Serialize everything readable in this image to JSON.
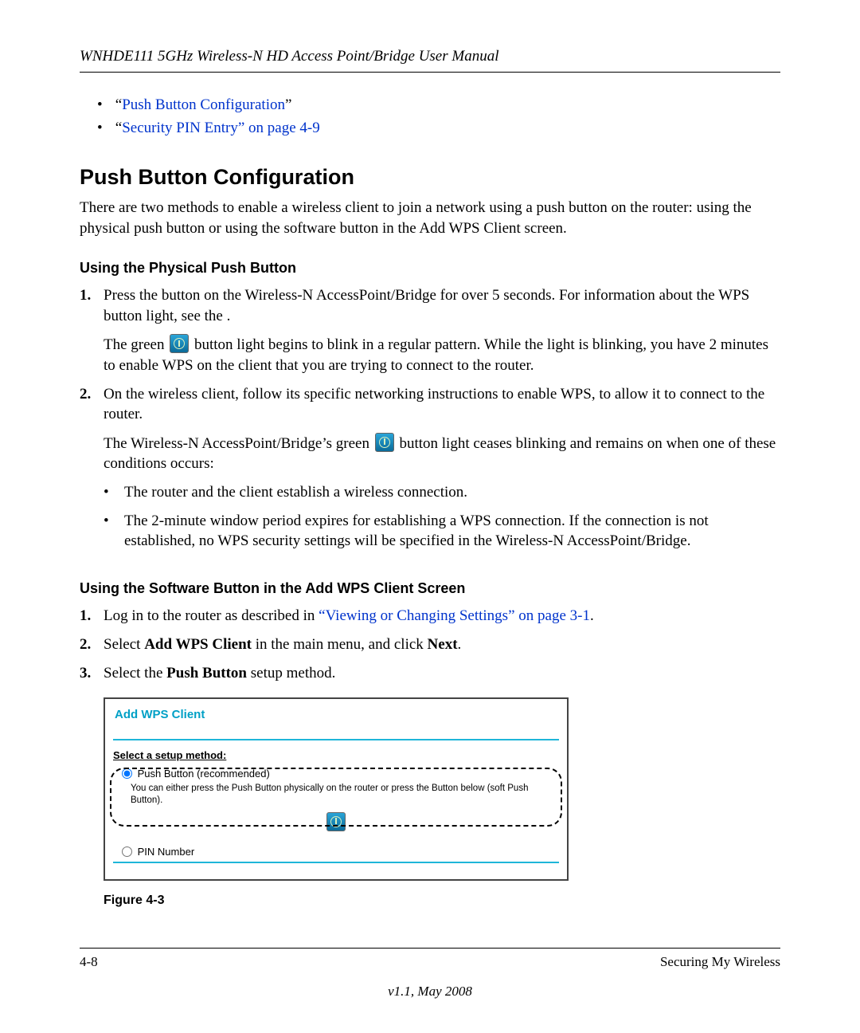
{
  "header": {
    "running_title": "WNHDE111 5GHz Wireless-N HD Access Point/Bridge User Manual"
  },
  "toc": {
    "items": [
      {
        "prefix": "“",
        "link": "Push Button Configuration",
        "suffix": "”"
      },
      {
        "prefix": "“",
        "link": "Security PIN Entry” on page 4-9",
        "suffix": ""
      }
    ]
  },
  "section": {
    "title": "Push Button Configuration",
    "intro": "There are two methods to enable a wireless client to join a network using a push button on the router: using the physical push button or using the software button in the Add WPS Client screen."
  },
  "physical": {
    "title": "Using the Physical Push Button",
    "step1": "Press the button on the Wireless-N AccessPoint/Bridge for over 5 seconds. For information about the WPS button light, see the  .",
    "step1b_pre": "The green ",
    "step1b_post": " button light begins to blink in a regular pattern. While the light is blinking, you have 2 minutes to enable WPS on the client that you are trying to connect to the router.",
    "step2": "On the wireless client, follow its specific networking instructions to enable WPS, to allow it to connect to the router.",
    "step2b_pre": "The Wireless-N AccessPoint/Bridge’s green ",
    "step2b_post": " button light ceases blinking and remains on when one of these conditions occurs:",
    "bullets": [
      "The router and the client establish a wireless connection.",
      "The 2-minute window period expires for establishing a WPS connection. If the connection is not established, no WPS security settings will be specified in the Wireless-N AccessPoint/Bridge."
    ]
  },
  "software": {
    "title": "Using the Software Button in the Add WPS Client Screen",
    "step1_pre": "Log in to the router as described in ",
    "step1_link": "“Viewing or Changing Settings” on page 3-1",
    "step1_post": ".",
    "step2_pre": "Select ",
    "step2_b1": "Add WPS Client",
    "step2_mid": " in the main menu, and click ",
    "step2_b2": "Next",
    "step2_post": ".",
    "step3_pre": "Select the ",
    "step3_b": "Push Button",
    "step3_post": " setup method."
  },
  "screenshot": {
    "title": "Add WPS Client",
    "label": "Select a setup method:",
    "opt1": "Push Button (recommended)",
    "opt1_desc": "You can either press the Push Button physically on the router or press the Button below (soft Push Button).",
    "opt2": "PIN Number"
  },
  "figure_caption": "Figure 4-3",
  "footer": {
    "page": "4-8",
    "section": "Securing My Wireless",
    "version": "v1.1, May 2008"
  }
}
